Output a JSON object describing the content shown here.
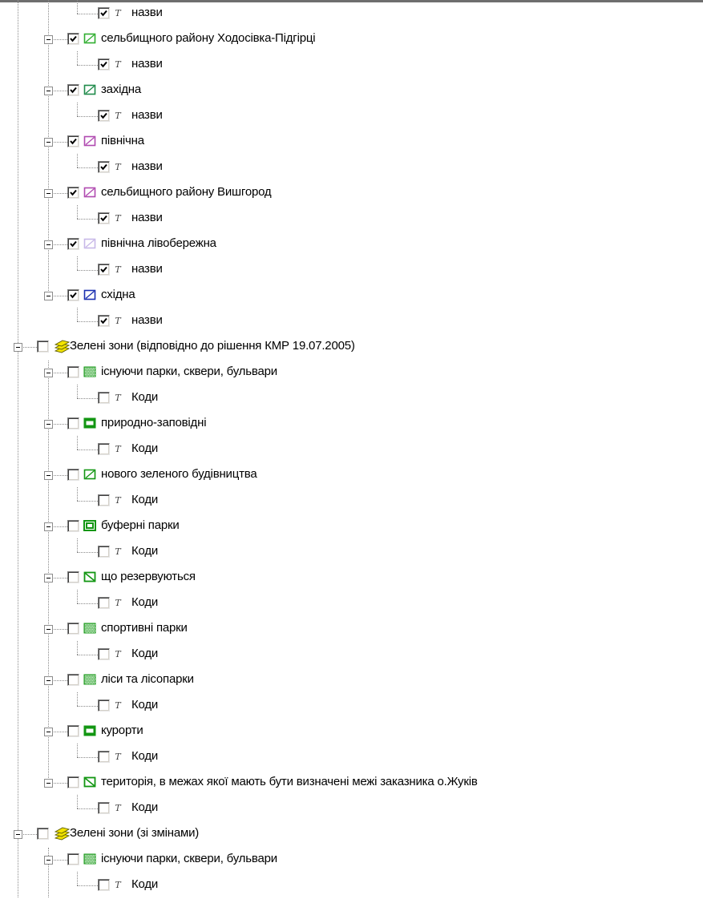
{
  "colors": {
    "tree_line": "#8a8a8a",
    "check_mark": "#000000",
    "green_1": "#2fae2f",
    "green_2": "#1e8a4a",
    "magenta": "#b04ab0",
    "light_violet": "#c8b8e8",
    "blue": "#1a2fb0",
    "green_zone": "#129612",
    "group_icon_yellow": "#f2e300"
  },
  "tree": {
    "items": [
      {
        "level": 3,
        "kind": "text",
        "checked": true,
        "label": "назви",
        "symbol": "text-t-icon"
      },
      {
        "level": 2,
        "kind": "zone",
        "checked": true,
        "label": "сельбищного району Ходосівка-Підгірці",
        "symbol": "hatch-green-symbol"
      },
      {
        "level": 3,
        "kind": "text",
        "checked": true,
        "label": "назви",
        "symbol": "text-t-icon"
      },
      {
        "level": 2,
        "kind": "zone",
        "checked": true,
        "label": "західна",
        "symbol": "hatch-darkgreen-symbol"
      },
      {
        "level": 3,
        "kind": "text",
        "checked": true,
        "label": "назви",
        "symbol": "text-t-icon"
      },
      {
        "level": 2,
        "kind": "zone",
        "checked": true,
        "label": "північна",
        "symbol": "hatch-magenta-symbol"
      },
      {
        "level": 3,
        "kind": "text",
        "checked": true,
        "label": "назви",
        "symbol": "text-t-icon"
      },
      {
        "level": 2,
        "kind": "zone",
        "checked": true,
        "label": "сельбищного району Вишгород",
        "symbol": "hatch-purple-symbol"
      },
      {
        "level": 3,
        "kind": "text",
        "checked": true,
        "label": "назви",
        "symbol": "text-t-icon"
      },
      {
        "level": 2,
        "kind": "zone",
        "checked": true,
        "label": "північна лівобережна",
        "symbol": "hatch-lightviolet-symbol"
      },
      {
        "level": 3,
        "kind": "text",
        "checked": true,
        "label": "назви",
        "symbol": "text-t-icon"
      },
      {
        "level": 2,
        "kind": "zone",
        "checked": true,
        "label": "східна",
        "symbol": "hatch-blue-symbol"
      },
      {
        "level": 3,
        "kind": "text",
        "checked": true,
        "label": "назви",
        "symbol": "text-t-icon"
      },
      {
        "level": 1,
        "kind": "group",
        "checked": false,
        "label": "Зелені зони (відповідно до рішення КМР 19.07.2005)",
        "symbol": "layer-group-icon"
      },
      {
        "level": 2,
        "kind": "zone",
        "checked": false,
        "label": "існуючи парки, сквери, бульвари",
        "symbol": "dotted-green-symbol"
      },
      {
        "level": 3,
        "kind": "text",
        "checked": false,
        "label": "Коди",
        "symbol": "text-t-icon"
      },
      {
        "level": 2,
        "kind": "zone",
        "checked": false,
        "label": "природно-заповідні",
        "symbol": "thick-border-green-symbol"
      },
      {
        "level": 3,
        "kind": "text",
        "checked": false,
        "label": "Коди",
        "symbol": "text-t-icon"
      },
      {
        "level": 2,
        "kind": "zone",
        "checked": false,
        "label": "нового зеленого будівництва",
        "symbol": "hatch-zone-green-symbol"
      },
      {
        "level": 3,
        "kind": "text",
        "checked": false,
        "label": "Коди",
        "symbol": "text-t-icon"
      },
      {
        "level": 2,
        "kind": "zone",
        "checked": false,
        "label": "буферні парки",
        "symbol": "inner-box-green-symbol"
      },
      {
        "level": 3,
        "kind": "text",
        "checked": false,
        "label": "Коди",
        "symbol": "text-t-icon"
      },
      {
        "level": 2,
        "kind": "zone",
        "checked": false,
        "label": "що резервуються",
        "symbol": "backslash-green-symbol"
      },
      {
        "level": 3,
        "kind": "text",
        "checked": false,
        "label": "Коди",
        "symbol": "text-t-icon"
      },
      {
        "level": 2,
        "kind": "zone",
        "checked": false,
        "label": "спортивні парки",
        "symbol": "dotted-green-symbol"
      },
      {
        "level": 3,
        "kind": "text",
        "checked": false,
        "label": "Коди",
        "symbol": "text-t-icon"
      },
      {
        "level": 2,
        "kind": "zone",
        "checked": false,
        "label": "ліси та лісопарки",
        "symbol": "dotted-green-symbol"
      },
      {
        "level": 3,
        "kind": "text",
        "checked": false,
        "label": "Коди",
        "symbol": "text-t-icon"
      },
      {
        "level": 2,
        "kind": "zone",
        "checked": false,
        "label": "курорти",
        "symbol": "thick-border-green-symbol"
      },
      {
        "level": 3,
        "kind": "text",
        "checked": false,
        "label": "Коди",
        "symbol": "text-t-icon"
      },
      {
        "level": 2,
        "kind": "zone",
        "checked": false,
        "label": "територія, в межах якої мають бути визначені межі заказника о.Жуків",
        "symbol": "backslash-green-symbol"
      },
      {
        "level": 3,
        "kind": "text",
        "checked": false,
        "label": "Коди",
        "symbol": "text-t-icon"
      },
      {
        "level": 1,
        "kind": "group",
        "checked": false,
        "label": "Зелені зони (зі змінами)",
        "symbol": "layer-group-icon"
      },
      {
        "level": 2,
        "kind": "zone",
        "checked": false,
        "label": "існуючи парки, сквери, бульвари",
        "symbol": "dotted-green-symbol"
      },
      {
        "level": 3,
        "kind": "text",
        "checked": false,
        "label": "Коди",
        "symbol": "text-t-icon"
      }
    ]
  }
}
